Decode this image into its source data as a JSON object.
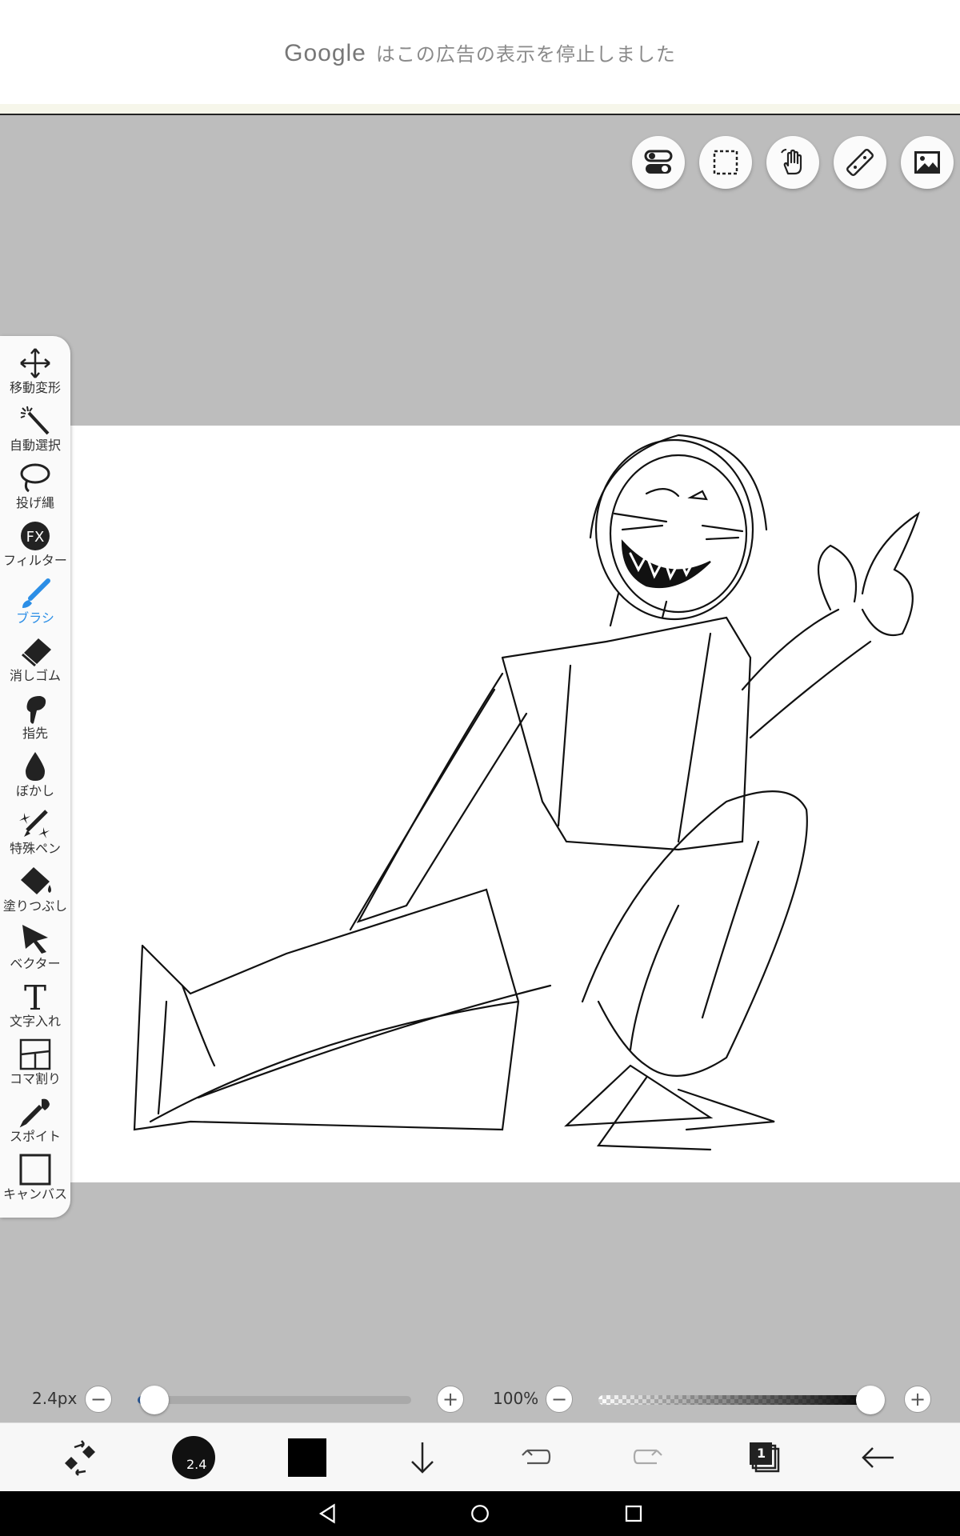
{
  "ad": {
    "brand": "Google",
    "message": "はこの広告の表示を停止しました"
  },
  "top_tools": [
    {
      "name": "toggle-icon"
    },
    {
      "name": "selection-icon"
    },
    {
      "name": "hand-icon"
    },
    {
      "name": "ruler-icon"
    },
    {
      "name": "image-icon"
    }
  ],
  "left_tools": [
    {
      "id": "move",
      "label": "移動変形",
      "icon": "move-icon"
    },
    {
      "id": "magic",
      "label": "自動選択",
      "icon": "magic-wand-icon"
    },
    {
      "id": "lasso",
      "label": "投げ縄",
      "icon": "lasso-icon"
    },
    {
      "id": "filter",
      "label": "フィルター",
      "icon": "fx-icon",
      "icon_text": "FX"
    },
    {
      "id": "brush",
      "label": "ブラシ",
      "icon": "brush-icon",
      "active": true
    },
    {
      "id": "eraser",
      "label": "消しゴム",
      "icon": "eraser-icon"
    },
    {
      "id": "finger",
      "label": "指先",
      "icon": "finger-icon"
    },
    {
      "id": "blur",
      "label": "ぼかし",
      "icon": "drop-icon"
    },
    {
      "id": "special",
      "label": "特殊ペン",
      "icon": "sparkle-pen-icon"
    },
    {
      "id": "fill",
      "label": "塗りつぶし",
      "icon": "bucket-icon"
    },
    {
      "id": "vector",
      "label": "ベクター",
      "icon": "cursor-icon"
    },
    {
      "id": "text",
      "label": "文字入れ",
      "icon": "text-icon",
      "icon_text": "T"
    },
    {
      "id": "frame",
      "label": "コマ割り",
      "icon": "frame-icon"
    },
    {
      "id": "eyedropper",
      "label": "スポイト",
      "icon": "eyedropper-icon"
    },
    {
      "id": "canvas",
      "label": "キャンバス",
      "icon": "canvas-icon"
    }
  ],
  "sliders": {
    "brush_size_label": "2.4px",
    "brush_size_fraction": 0.06,
    "zoom_label": "100%",
    "opacity_fraction": 1.0,
    "minus": "−",
    "plus": "+"
  },
  "bottom_bar": {
    "brush_size_text": "2.4",
    "color": "#000000",
    "layer_count": "1"
  },
  "colors": {
    "accent": "#2b8ee6",
    "canvas_bg": "#ffffff",
    "workspace_bg": "#bdbdbd"
  }
}
